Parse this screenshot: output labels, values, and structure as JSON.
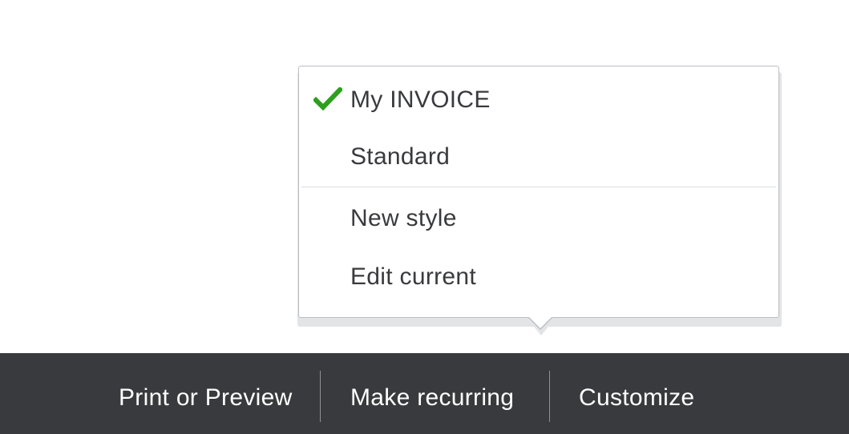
{
  "style_menu": {
    "items": [
      {
        "label": "My INVOICE",
        "selected": true
      },
      {
        "label": "Standard",
        "selected": false
      }
    ],
    "actions": [
      {
        "label": "New style"
      },
      {
        "label": "Edit current"
      }
    ],
    "check_color": "#2ca01c"
  },
  "toolbar": {
    "print_label": "Print or Preview",
    "recurring_label": "Make recurring",
    "customize_label": "Customize",
    "background": "#393a3d"
  }
}
